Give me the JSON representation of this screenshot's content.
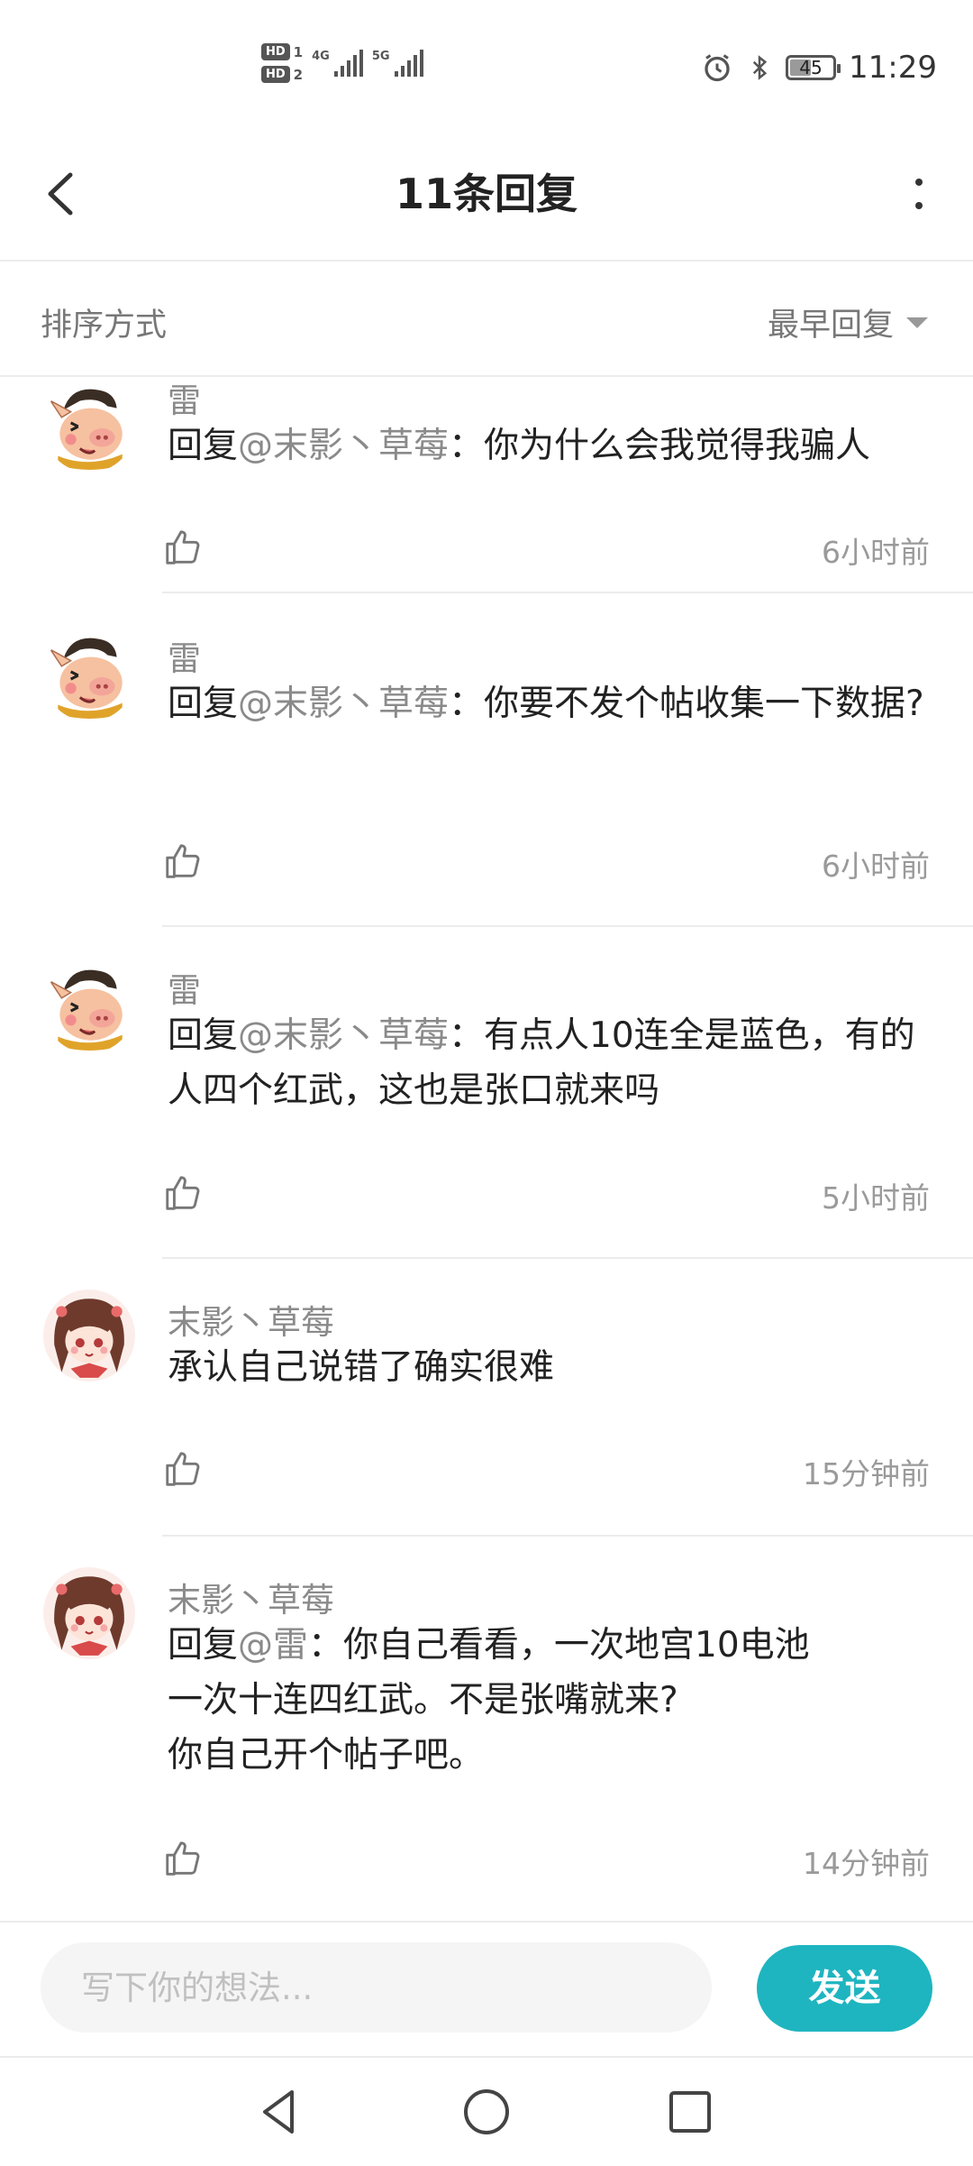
{
  "status": {
    "hd1": "HD",
    "hd1_num": "1",
    "hd2": "HD",
    "hd2_num": "2",
    "net1": "4G",
    "net2": "5G",
    "battery": "45",
    "time": "11:29"
  },
  "header": {
    "title": "11条回复"
  },
  "sort": {
    "label": "排序方式",
    "value": "最早回复"
  },
  "comments": [
    {
      "user": "雷",
      "prefix": "回复",
      "mention": "@末影丶草莓",
      "sep": "：",
      "text": "你为什么会我觉得我骗人",
      "time": "6小时前"
    },
    {
      "user": "雷",
      "prefix": "回复",
      "mention": "@末影丶草莓",
      "sep": "：",
      "text": "你要不发个帖收集一下数据?",
      "time": "6小时前"
    },
    {
      "user": "雷",
      "prefix": "回复",
      "mention": "@末影丶草莓",
      "sep": "：",
      "text": "有点人10连全是蓝色，有的人四个红武，这也是张口就来吗",
      "time": "5小时前"
    },
    {
      "user": "末影丶草莓",
      "prefix": "",
      "mention": "",
      "sep": "",
      "text": "承认自己说错了确实很难",
      "time": "15分钟前"
    },
    {
      "user": "末影丶草莓",
      "prefix": "回复",
      "mention": "@雷",
      "sep": "：",
      "text": "你自己看看，一次地宫10电池",
      "text2": "一次十连四红武。不是张嘴就来?",
      "text3": "你自己开个帖子吧。",
      "time": "14分钟前"
    }
  ],
  "input": {
    "placeholder": "写下你的想法..."
  },
  "send_label": "发送",
  "colors": {
    "accent": "#1eb5c0",
    "mention": "#8a8a8a"
  }
}
